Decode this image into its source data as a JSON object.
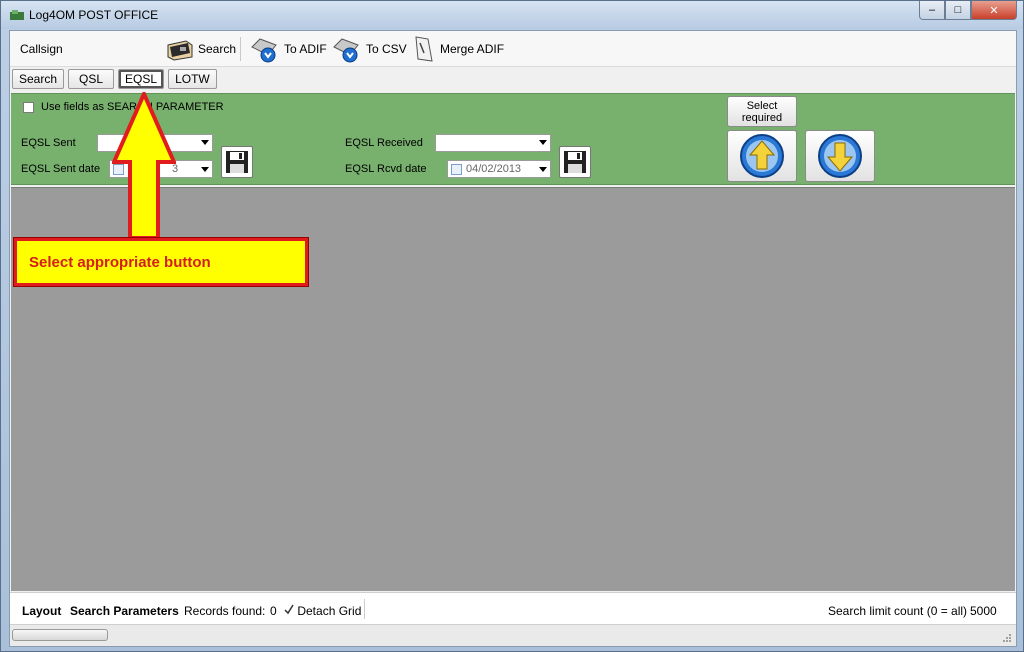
{
  "window": {
    "title": "Log4OM POST OFFICE",
    "controls": [
      "–",
      "□",
      "✕"
    ]
  },
  "toolbar": {
    "callsign_label": "Callsign",
    "callsign_value": "",
    "search_label": "Search",
    "to_adif_label": "To ADIF",
    "to_csv_label": "To CSV",
    "merge_adif_label": "Merge ADIF"
  },
  "tabs": [
    {
      "label": "Search",
      "active": false
    },
    {
      "label": "QSL",
      "active": false
    },
    {
      "label": "EQSL",
      "active": true
    },
    {
      "label": "LOTW",
      "active": false
    }
  ],
  "panel": {
    "use_fields_label": "Use fields as SEARCH PARAMETER",
    "eqsl_sent_label": "EQSL Sent",
    "eqsl_sent_value": "",
    "eqsl_sent_date_label": "EQSL Sent date",
    "eqsl_sent_date_value": "3",
    "eqsl_received_label": "EQSL Received",
    "eqsl_received_value": "",
    "eqsl_rcvd_date_label": "EQSL Rcvd date",
    "eqsl_rcvd_date_value": "04/02/2013",
    "select_required_label": "Select required",
    "background_color": "#78b06e"
  },
  "status": {
    "layout_label": "Layout",
    "search_parameters_label": "Search Parameters",
    "records_found_label": "Records found:",
    "records_found_value": "0",
    "detach_grid_label": "Detach Grid",
    "search_limit_label": "Search limit count (0 = all)",
    "search_limit_value": "5000"
  },
  "annotation": {
    "callout_text": "Select appropriate button",
    "box_color": "#ffff00",
    "border_color": "#e11c1c"
  },
  "icons": [
    "app-icon",
    "search-icon",
    "to-adif-icon",
    "to-csv-icon",
    "merge-adif-icon",
    "save-icon",
    "up-arrow-icon",
    "down-arrow-icon",
    "check-icon"
  ]
}
